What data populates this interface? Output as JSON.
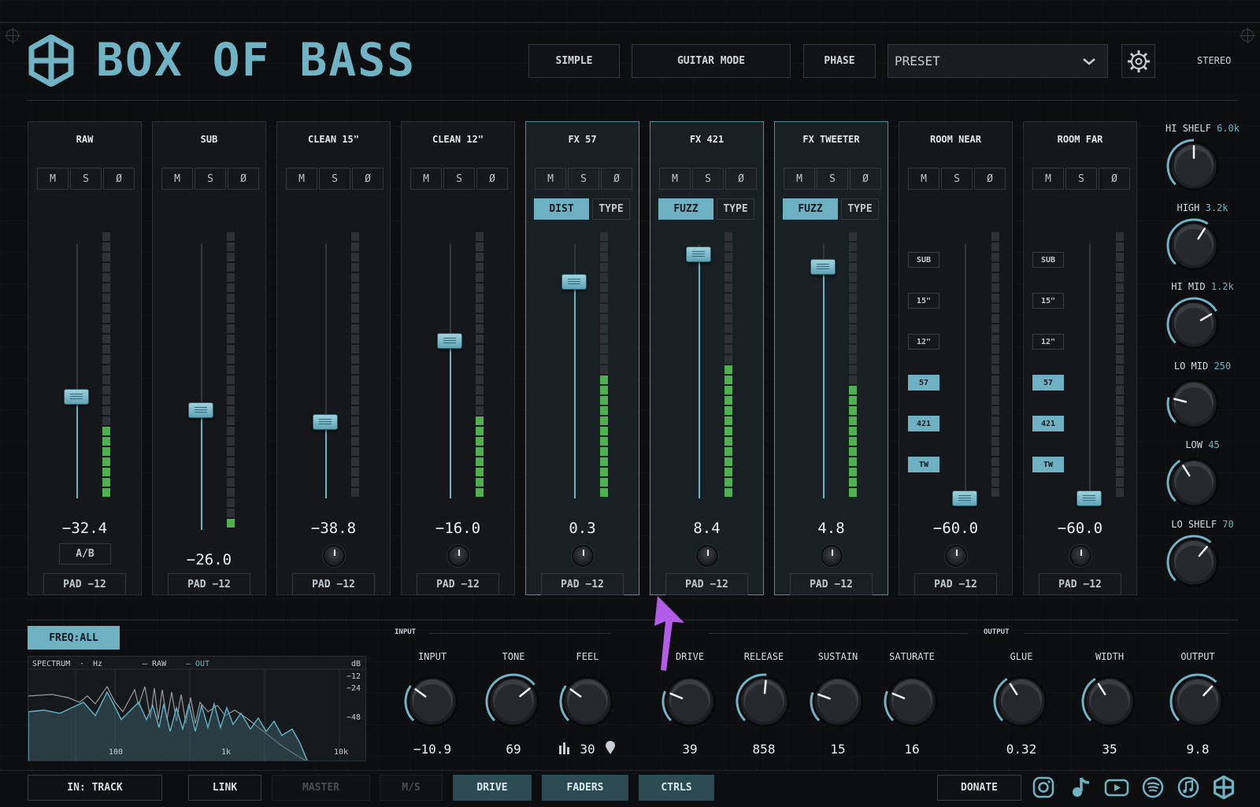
{
  "header": {
    "title": "BOX OF BASS",
    "buttons": [
      "SIMPLE",
      "GUITAR MODE",
      "PHASE"
    ],
    "preset": "PRESET",
    "stereo": "STEREO"
  },
  "channel_buttons": {
    "mute": "M",
    "solo": "S",
    "phase": "Ø",
    "pad": "PAD −12",
    "ab": "A/B",
    "type": "TYPE"
  },
  "channels": [
    {
      "name": "RAW",
      "value": "−32.4",
      "fader": 0.4,
      "meter": 7
    },
    {
      "name": "SUB",
      "value": "−26.0",
      "fader": 0.42,
      "meter": 1
    },
    {
      "name": "CLEAN 15\"",
      "value": "−38.8",
      "fader": 0.3,
      "meter": 0
    },
    {
      "name": "CLEAN 12\"",
      "value": "−16.0",
      "fader": 0.62,
      "meter": 8
    },
    {
      "name": "FX 57",
      "value": "0.3",
      "fader": 0.85,
      "meter": 12,
      "mode": "DIST"
    },
    {
      "name": "FX 421",
      "value": "8.4",
      "fader": 0.96,
      "meter": 13,
      "mode": "FUZZ"
    },
    {
      "name": "FX TWEETER",
      "value": "4.8",
      "fader": 0.91,
      "meter": 11,
      "mode": "FUZZ"
    },
    {
      "name": "ROOM NEAR",
      "value": "−60.0",
      "fader": 0.0,
      "meter": 0
    },
    {
      "name": "ROOM FAR",
      "value": "−60.0",
      "fader": 0.0,
      "meter": 0
    }
  ],
  "routes": [
    {
      "label": "SUB",
      "on": false
    },
    {
      "label": "15\"",
      "on": false
    },
    {
      "label": "12\"",
      "on": false
    },
    {
      "label": "57",
      "on": true
    },
    {
      "label": "421",
      "on": true
    },
    {
      "label": "TW",
      "on": true
    }
  ],
  "eq": [
    {
      "label": "HI SHELF",
      "value": "6.0k",
      "level": 0.5
    },
    {
      "label": "HIGH",
      "value": "3.2k",
      "level": 0.62
    },
    {
      "label": "HI MID",
      "value": "1.2k",
      "level": 0.72
    },
    {
      "label": "LO MID",
      "value": "250",
      "level": 0.22
    },
    {
      "label": "LOW",
      "value": "45",
      "level": 0.38
    },
    {
      "label": "LO SHELF",
      "value": "70",
      "level": 0.65
    }
  ],
  "spectrum": {
    "freq_button": "FREQ:ALL",
    "legend_spectrum": "SPECTRUM",
    "legend_dot": "·",
    "legend_hz": "Hz",
    "legend_raw": "— RAW",
    "legend_out": "— OUT",
    "db_label": "dB",
    "db_ticks": [
      "−12",
      "−24",
      "−48"
    ],
    "freq_ticks": [
      "100",
      "1k",
      "10k"
    ]
  },
  "groups": {
    "input": "INPUT",
    "output": "OUTPUT"
  },
  "controls": [
    {
      "label": "INPUT",
      "value": "−10.9",
      "level": 0.3
    },
    {
      "label": "TONE",
      "value": "69",
      "level": 0.69
    },
    {
      "label": "FEEL",
      "value": "30",
      "level": 0.3
    },
    {
      "label": "DRIVE",
      "value": "39",
      "level": 0.25
    },
    {
      "label": "RELEASE",
      "value": "858",
      "level": 0.52
    },
    {
      "label": "SUSTAIN",
      "value": "15",
      "level": 0.24
    },
    {
      "label": "SATURATE",
      "value": "16",
      "level": 0.25
    },
    {
      "label": "GLUE",
      "value": "0.32",
      "level": 0.38
    },
    {
      "label": "WIDTH",
      "value": "35",
      "level": 0.38
    },
    {
      "label": "OUTPUT",
      "value": "9.8",
      "level": 0.66
    }
  ],
  "footer": {
    "in_track": "IN: TRACK",
    "link": "LINK",
    "master": "MASTER",
    "ms": "M/S",
    "tabs": [
      "DRIVE",
      "FADERS",
      "CTRLS"
    ],
    "donate": "DONATE"
  },
  "colors": {
    "accent": "#6fb3c5",
    "meter_green": "#4fb04f",
    "panel": "#15171a"
  }
}
